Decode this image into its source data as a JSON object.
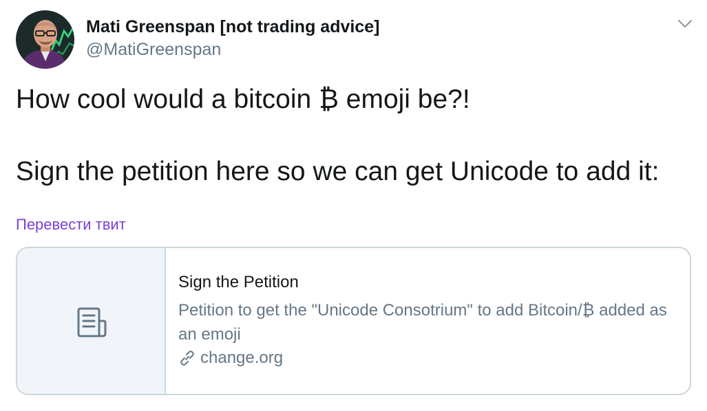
{
  "author": {
    "display_name": "Mati Greenspan [not trading advice]",
    "handle": "@MatiGreenspan"
  },
  "tweet": {
    "line1": "How cool would a bitcoin ₿ emoji be?!",
    "line2": "Sign the petition here so we can get Unicode to add it:"
  },
  "translate_link": "Перевести твит",
  "card": {
    "title": "Sign the Petition",
    "description": "Petition to get the \"Unicode Consotrium\" to add Bitcoin/₿ added as an emoji",
    "domain": "change.org"
  },
  "icons": {
    "menu": "chevron-down-icon",
    "card_thumb": "document-icon",
    "domain": "link-icon"
  },
  "colors": {
    "text": "#14171a",
    "secondary": "#657786",
    "translate": "#7c3fd6",
    "card_border": "#ccd6dd",
    "card_thumb_bg": "#f1f5f9"
  }
}
